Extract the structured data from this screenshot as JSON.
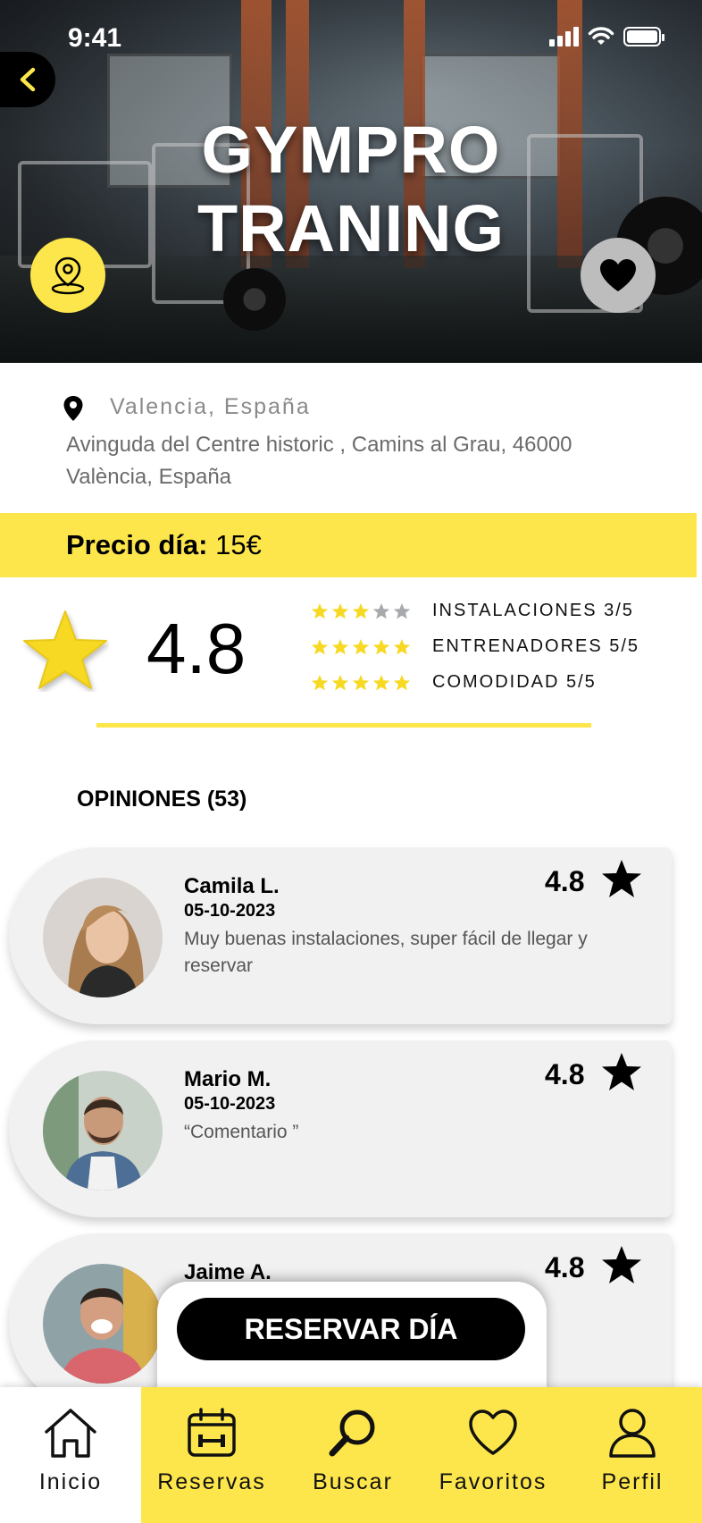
{
  "status_bar": {
    "time": "9:41"
  },
  "hero": {
    "title_line1": "GYMPRO",
    "title_line2": "TRANING"
  },
  "location": {
    "city": "Valencia, España",
    "address": "Avinguda del Centre historic , Camins al Grau, 46000 València, España"
  },
  "price": {
    "label": "Precio día:",
    "value": "15€"
  },
  "rating": {
    "overall": "4.8",
    "criteria": [
      {
        "label": "INSTALACIONES 3/5",
        "stars": 3
      },
      {
        "label": "ENTRENADORES 5/5",
        "stars": 5
      },
      {
        "label": "COMODIDAD 5/5",
        "stars": 5
      }
    ],
    "star_color": "#f7d923",
    "empty_star_color": "#a7a9ac"
  },
  "opinions": {
    "title": "OPINIONES (53)",
    "items": [
      {
        "name": "Camila  L.",
        "date": "05-10-2023",
        "text": "Muy buenas instalaciones, super fácil de llegar y reservar",
        "score": "4.8"
      },
      {
        "name": "Mario M.",
        "date": "05-10-2023",
        "text": "“Comentario ”",
        "score": "4.8"
      },
      {
        "name": "Jaime A.",
        "date": "",
        "text": "",
        "score": "4.8"
      }
    ]
  },
  "book_button": {
    "label": "RESERVAR DÍA"
  },
  "nav": {
    "items": [
      {
        "label": "Inicio",
        "icon": "home-icon",
        "active": true
      },
      {
        "label": "Reservas",
        "icon": "calendar-icon",
        "active": false
      },
      {
        "label": "Buscar",
        "icon": "search-icon",
        "active": false
      },
      {
        "label": "Favoritos",
        "icon": "heart-icon",
        "active": false
      },
      {
        "label": "Perfil",
        "icon": "user-icon",
        "active": false
      }
    ]
  },
  "colors": {
    "accent": "#fde64b",
    "dark": "#000000"
  }
}
